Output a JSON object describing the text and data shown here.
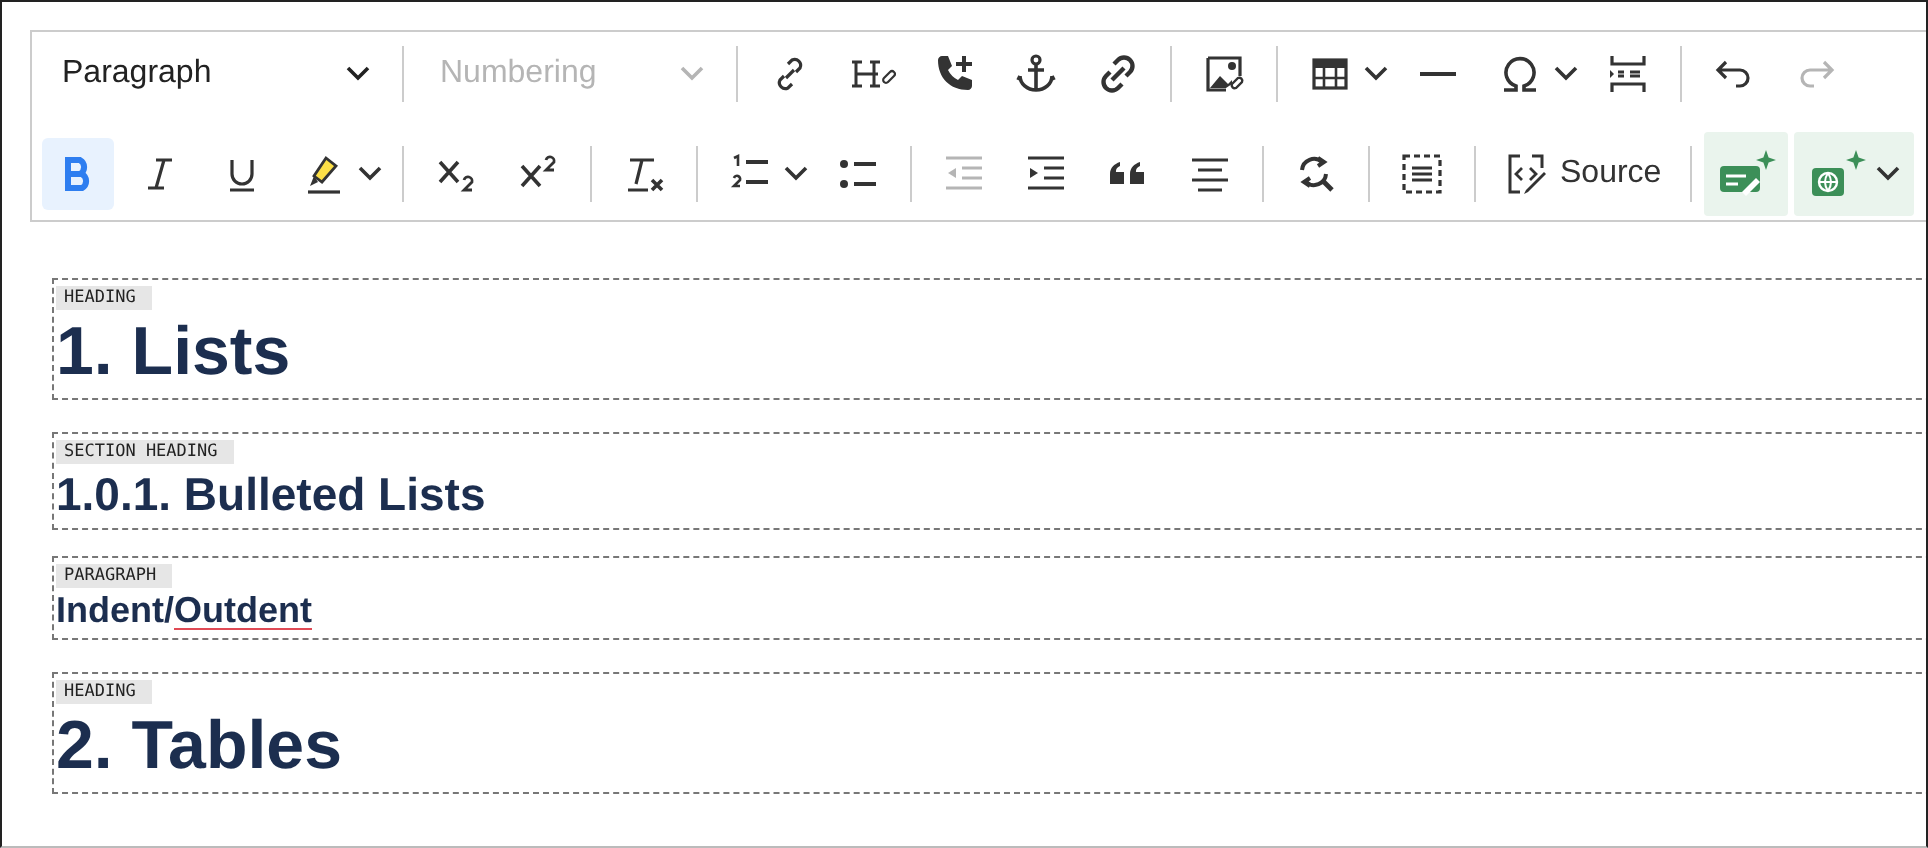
{
  "toolbar": {
    "style_dropdown": {
      "value": "Paragraph",
      "disabled": false
    },
    "numbering_dropdown": {
      "value": "Numbering",
      "disabled": true
    },
    "bold": {
      "selected": true
    },
    "italic": {
      "selected": false
    },
    "underline": {
      "selected": false
    },
    "subscript": {
      "selected": false
    },
    "superscript": {
      "selected": false
    },
    "outdent": {
      "disabled": true
    },
    "redo": {
      "disabled": true
    },
    "source": {
      "label": "Source"
    }
  },
  "blocks": [
    {
      "kind": "heading",
      "tag": "HEADING",
      "segments": [
        {
          "text": "1. Lists",
          "misspelled": false
        }
      ]
    },
    {
      "kind": "section-heading",
      "tag": "SECTION HEADING",
      "segments": [
        {
          "text": "1.0.1. Bulleted Lists",
          "misspelled": false
        }
      ]
    },
    {
      "kind": "paragraph",
      "tag": "PARAGRAPH",
      "segments": [
        {
          "text": "Indent/",
          "misspelled": false
        },
        {
          "text": "Outdent",
          "misspelled": true
        }
      ]
    },
    {
      "kind": "heading",
      "tag": "HEADING",
      "segments": [
        {
          "text": "2. Tables",
          "misspelled": false
        }
      ]
    }
  ]
}
